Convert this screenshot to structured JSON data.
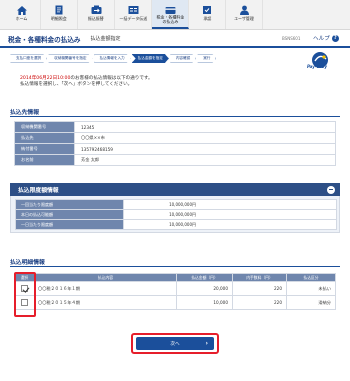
{
  "nav": {
    "items": [
      {
        "label": "ホーム"
      },
      {
        "label": "明細照会"
      },
      {
        "label": "振込振替"
      },
      {
        "label": "一括データ伝送"
      },
      {
        "label": "税金・各種料金",
        "label2": "の払込み"
      },
      {
        "label": "承認"
      },
      {
        "label": "ユーザ管理"
      }
    ]
  },
  "header": {
    "title": "税金・各種料金の払込み",
    "subtitle": "払込金額指定",
    "screen_id": "BSNS601",
    "help": "ヘルプ"
  },
  "steps": [
    "支払口座を選択",
    "収納機関番号を指定",
    "払込情報を入力",
    "払込金額を指定",
    "内容確認",
    "実行"
  ],
  "logo": {
    "text": "Pay-easy"
  },
  "notice": {
    "date_prefix": "2014年06月22日10:00",
    "line1_rest": "のお客様の払込情報は以下の通りです。",
    "line2": "払込情報を選択し、「次へ」ボタンを押してください。"
  },
  "payee": {
    "title": "払込先情報",
    "rows": [
      {
        "k": "収納機関番号",
        "v": "12345"
      },
      {
        "k": "払込先",
        "v": "〇〇県××市"
      },
      {
        "k": "納付番号",
        "v": "135792468159"
      },
      {
        "k": "お名前",
        "v": "芳金 太郎"
      }
    ]
  },
  "limits": {
    "title": "払込限度額情報",
    "rows": [
      {
        "k": "一回当たり限度額",
        "v": "10,000,000円"
      },
      {
        "k": "本日の払込可能額",
        "v": "10,000,000円"
      },
      {
        "k": "一日当たり限度額",
        "v": "10,000,000円"
      }
    ]
  },
  "payments": {
    "title": "払込明細情報",
    "headers": [
      "選択",
      "払込内容",
      "払込金額（円）",
      "内手数料（円）",
      "払込区分"
    ],
    "rows": [
      {
        "content": "〇〇税２０１６年１期",
        "amount": "20,000",
        "fee": "220",
        "kind": "未払い",
        "checked": true
      },
      {
        "content": "〇〇税２０１５年４期",
        "amount": "10,000",
        "fee": "220",
        "kind": "滞納分",
        "checked": false
      }
    ]
  },
  "next_button": {
    "label": "次へ"
  }
}
